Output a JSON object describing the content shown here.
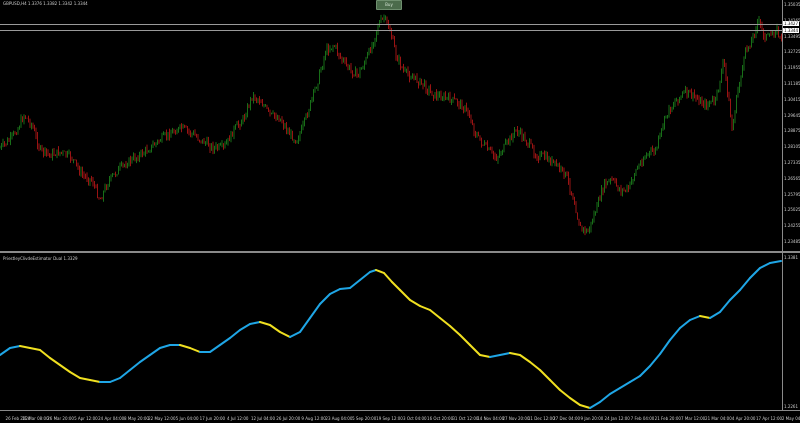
{
  "header": {
    "symbol_info": "GBPUSD,H4   1.3376  1.3382  1.3342  1.3344",
    "buy_label": "Buy"
  },
  "main_chart": {
    "price_line_label": "1.3344",
    "upper_line_label": "1.3427",
    "up_color": "#1f8a1f",
    "down_color": "#c01818"
  },
  "indicator": {
    "name": "PriestleyClivdeEstimator Dual 1.3329",
    "rising_color": "#1fa6e6",
    "falling_color": "#f0e020"
  },
  "price_axis": [
    "1.35035",
    "1.34265",
    "1.33495",
    "1.32725",
    "1.31955",
    "1.31185",
    "1.30415",
    "1.29645",
    "1.28875",
    "1.28105",
    "1.27335",
    "1.26565",
    "1.25795",
    "1.25025",
    "1.24255",
    "1.23485"
  ],
  "indicator_axis": [
    "1.3381",
    "1.2261"
  ],
  "time_axis": [
    "26 Feb 2024",
    "11 Mar 08:00",
    "26 Mar 20:00",
    "5 Apr 12:00",
    "24 Apr 04:00",
    "8 May 20:00",
    "22 May 12:00",
    "5 Jun 04:00",
    "17 Jun 20:00",
    "4 Jul 12:00",
    "12 Jul 04:00",
    "26 Jul 20:00",
    "9 Aug 12:00",
    "23 Aug 04:00",
    "5 Sep 20:00",
    "19 Sep 12:00",
    "3 Oct 04:00",
    "16 Oct 20:00",
    "31 Oct 12:00",
    "14 Nov 04:00",
    "27 Nov 20:00",
    "11 Dec 12:00",
    "27 Dec 04:00",
    "9 Jan 20:00",
    "24 Jan 12:00",
    "7 Feb 04:00",
    "21 Feb 20:00",
    "7 Mar 12:00",
    "21 Mar 04:00",
    "4 Apr 20:00",
    "17 Apr 12:00",
    "2 May 04:00"
  ]
}
